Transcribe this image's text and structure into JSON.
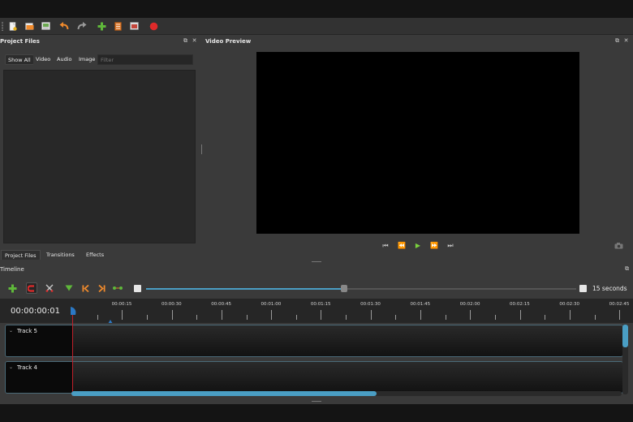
{
  "toolbar": {
    "icons": [
      "new-project-icon",
      "open-project-icon",
      "save-project-icon",
      "undo-icon",
      "redo-icon",
      "import-files-icon",
      "profile-icon",
      "export-video-icon",
      "record-icon"
    ]
  },
  "project_files": {
    "title": "Project Files",
    "filters": [
      "Show All",
      "Video",
      "Audio",
      "Image"
    ],
    "filter_placeholder": "Filter",
    "tabs": [
      "Project Files",
      "Transitions",
      "Effects"
    ]
  },
  "video_preview": {
    "title": "Video Preview"
  },
  "timeline": {
    "title": "Timeline",
    "timecode": "00:00:00:01",
    "zoom_label": "15 seconds",
    "zoom_level": 0.46,
    "ruler_labels": [
      "00:00:15",
      "00:00:30",
      "00:00:45",
      "00:01:00",
      "00:01:15",
      "00:01:30",
      "00:01:45",
      "00:02:00",
      "00:02:15",
      "00:02:30",
      "00:02:45"
    ],
    "tracks": [
      {
        "name": "Track 5"
      },
      {
        "name": "Track 4"
      }
    ],
    "scroll_fraction": 0.5
  },
  "colors": {
    "accent": "#4a9ec4",
    "playhead": "#c0202a",
    "green": "#5fb83a",
    "orange": "#e07a2a",
    "record": "#e02a2a"
  }
}
